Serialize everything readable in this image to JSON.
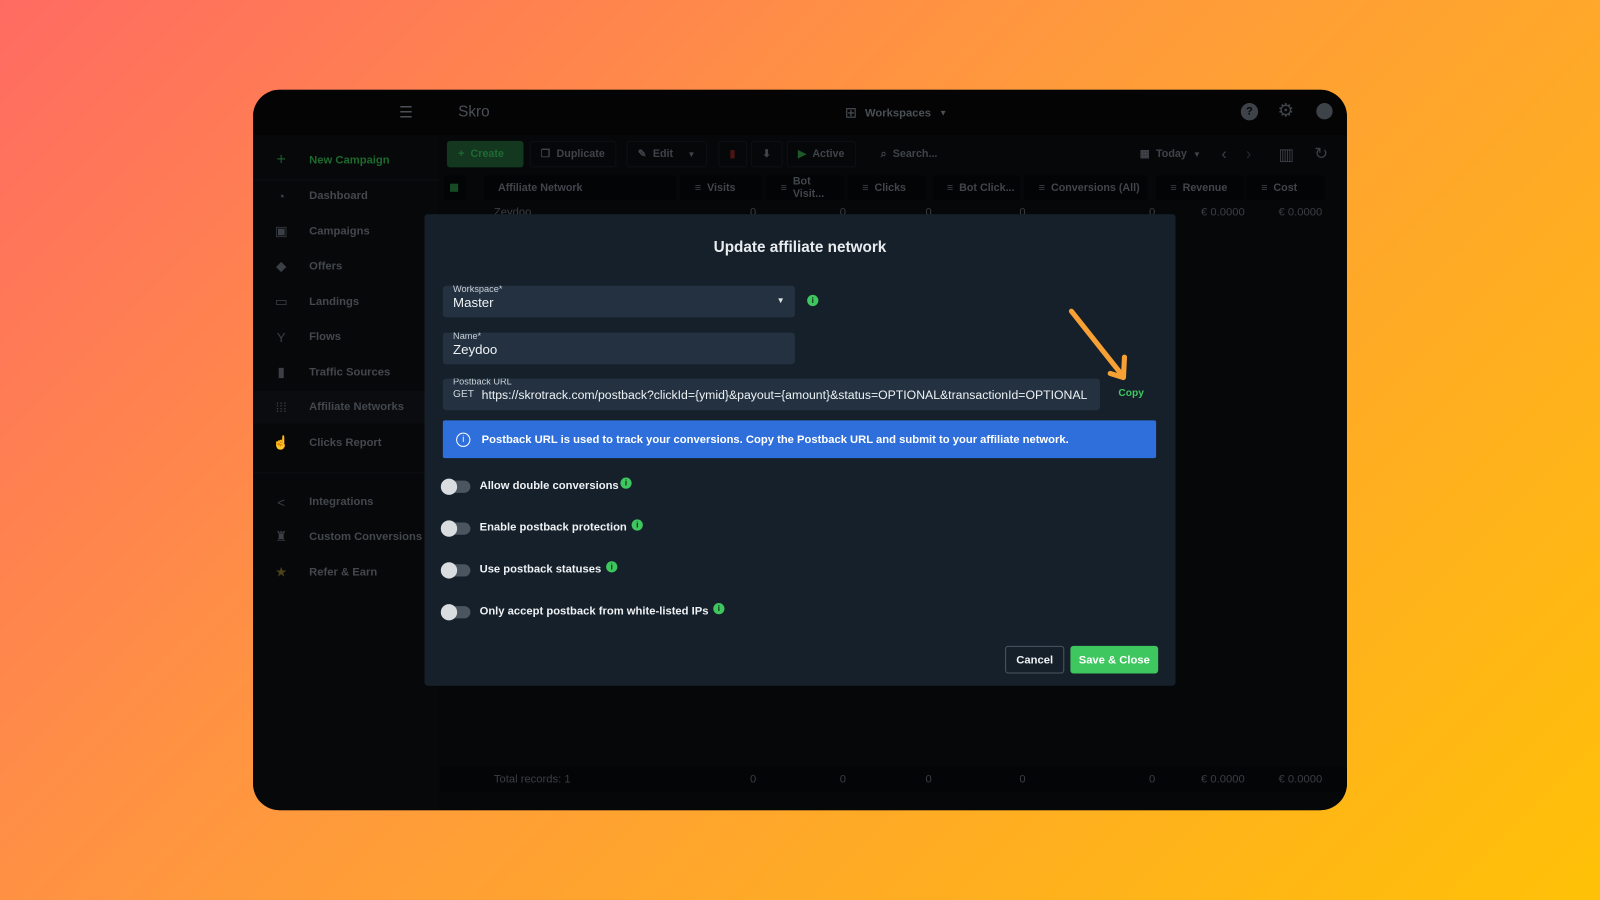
{
  "app": {
    "brand": "Skro",
    "workspaces_label": "Workspaces"
  },
  "sidebar": {
    "new_campaign": "New Campaign",
    "items": [
      {
        "label": "Dashboard",
        "icon": "gauge-icon"
      },
      {
        "label": "Campaigns",
        "icon": "briefcase-icon"
      },
      {
        "label": "Offers",
        "icon": "tag-icon"
      },
      {
        "label": "Landings",
        "icon": "monitor-icon"
      },
      {
        "label": "Flows",
        "icon": "flow-icon"
      },
      {
        "label": "Traffic Sources",
        "icon": "traffic-light-icon"
      },
      {
        "label": "Affiliate Networks",
        "icon": "grid-dots-icon"
      },
      {
        "label": "Clicks Report",
        "icon": "pointer-hand-icon"
      },
      {
        "label": "Integrations",
        "icon": "share-icon"
      },
      {
        "label": "Custom Conversions",
        "icon": "trophy-icon"
      },
      {
        "label": "Refer & Earn",
        "icon": "star-icon"
      }
    ]
  },
  "toolbar": {
    "create": "Create",
    "duplicate": "Duplicate",
    "edit": "Edit",
    "active": "Active",
    "search_placeholder": "Search...",
    "date": "Today"
  },
  "table": {
    "columns": [
      "Affiliate Network",
      "Visits",
      "Bot Visit...",
      "Clicks",
      "Bot Click...",
      "Conversions (All)",
      "Revenue",
      "Cost"
    ],
    "rows": [
      {
        "name": "Zeydoo",
        "visits": "0",
        "bot_visits": "0",
        "clicks": "0",
        "bot_clicks": "0",
        "conversions": "0",
        "revenue": "€ 0.0000",
        "cost": "€ 0.0000"
      }
    ],
    "footer": {
      "label": "Total records: 1",
      "visits": "0",
      "bot_visits": "0",
      "clicks": "0",
      "bot_clicks": "0",
      "conversions": "0",
      "revenue": "€ 0.0000",
      "cost": "€ 0.0000"
    }
  },
  "modal": {
    "title": "Update affiliate network",
    "workspace_label": "Workspace*",
    "workspace_value": "Master",
    "name_label": "Name*",
    "name_value": "Zeydoo",
    "postback_label": "Postback URL",
    "postback_method": "GET",
    "postback_url": "https://skrotrack.com/postback?clickId={ymid}&payout={amount}&status=OPTIONAL&transactionId=OPTIONAL",
    "copy_label": "Copy",
    "info_text": "Postback URL is used to track your conversions. Copy the Postback URL and submit to your affiliate network.",
    "toggles": [
      {
        "label": "Allow double conversions",
        "on": false
      },
      {
        "label": "Enable postback protection",
        "on": false
      },
      {
        "label": "Use postback statuses",
        "on": false
      },
      {
        "label": "Only accept postback from white-listed IPs",
        "on": false
      }
    ],
    "cancel": "Cancel",
    "save": "Save & Close"
  },
  "colors": {
    "accent_green": "#3ec75f",
    "info_blue": "#2f6fdc",
    "arrow": "#f7a134"
  }
}
